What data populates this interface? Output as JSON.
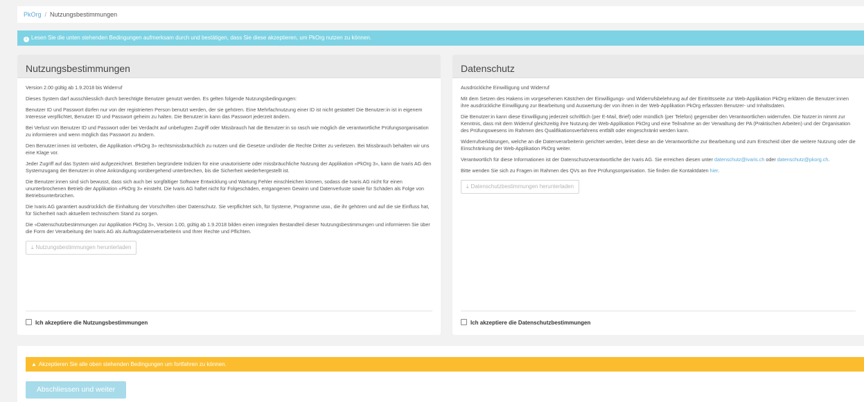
{
  "breadcrumb": {
    "root": "PkOrg",
    "separator": "/",
    "current": "Nutzungsbestimmungen"
  },
  "info_banner": "Lesen Sie die unten stehenden Bedingungen aufmerksam durch und bestätigen, dass Sie diese akzeptieren, um PkOrg nutzen zu können.",
  "terms": {
    "title": "Nutzungsbestimmungen",
    "paragraphs": [
      "Version 2.00 gültig ab 1.9.2018 bis Widerruf",
      "Dieses System darf ausschliesslich durch berechtigte Benutzer genutzt werden. Es gelten folgende Nutzungsbedingungen:",
      "Benutzer ID und Passwort dürfen nur von der registrierten Person benutzt werden, der sie gehören. Eine Mehrfachnutzung einer ID ist nicht gestattet! Die Benutzer:in ist in eigenem Interesse verpflichtet, Benutzer ID und Passwort geheim zu halten. Die Benutzer:in kann das Passwort jederzeit ändern.",
      "Bei Verlust von Benutzer ID und Passwort oder bei Verdacht auf unbefugten Zugriff oder Missbrauch hat die Benutzer:in so rasch wie möglich die verantwortliche Prüfungsorganisation zu informieren und wenn möglich das Passwort zu ändern.",
      "Den Benutzer:innen ist verboten, die Applikation «PkOrg 3» rechtsmissbräuchlich zu nutzen und die Gesetze und/oder die Rechte Dritter zu verletzen. Bei Missbrauch behalten wir uns eine Klage vor.",
      "Jeder Zugriff auf das System wird aufgezeichnet. Bestehen begründete Indizien für eine unautorisierte oder missbräuchliche Nutzung der Applikation «PkOrg 3», kann die Ivaris AG den Systemzugang der Benutzer:in ohne Ankündigung vorübergehend unterbrechen, bis die Sicherheit wiederhergestellt ist.",
      "Die Benutzer:innen sind sich bewusst, dass sich auch bei sorgfältiger Software Entwicklung und Wartung Fehler einschleichen können, sodass die Ivaris AG nicht für einen ununterbrochenen Betrieb der Applikation «PkOrg 3» einsteht. Die Ivaris AG haftet nicht für Folgeschäden, entgangenen Gewinn und Datenverluste sowie für Schäden als Folge von Betriebsunterbrüchen.",
      "Die Ivaris AG garantiert ausdrücklich die Einhaltung der Vorschriften über Datenschutz. Sie verpflichtet sich, für Systeme, Programme usw., die ihr gehören und auf die sie Einfluss hat, für Sicherheit nach aktuellem technischem Stand zu sorgen.",
      "Die «Datenschutzbestimmungen zur Applikation PkOrg 3», Version 1.00, gültig ab 1.9.2018 bilden einen integralen Bestandteil dieser Nutzungsbestimmungen und informieren Sie über die Form der Verarbeitung der Ivaris AG als Auftragsdatenverarbeiterin und Ihrer Rechte und Pflichten."
    ],
    "download_label": "Nutzungsbestimmungen herunterladen",
    "accept_label": "Ich akzeptiere die Nutzungsbestimmungen"
  },
  "privacy": {
    "title": "Datenschutz",
    "p1": "Ausdrückliche Einwilligung und Widerruf",
    "p2": "Mit dem Setzen des Hakens im vorgesehenen Kästchen der Einwilligungs- und Widerrufsbelehrung auf der Eintrittsseite zur Web-Applikation PkOrg erklären die Benutzer:innen ihre ausdrückliche Einwilligung zur Bearbeitung und Auswertung der von ihnen in der Web-Applikation PkOrg erfassten Benutzer- und Inhaltsdaten.",
    "p3": "Die Benutzer:in kann diese Einwilligung jederzeit schriftlich (per E-Mail, Brief) oder mündlich (per Telefon) gegenüber den Verantwortlichen widerrufen. Die Nutzer:in nimmt zur Kenntnis, dass mit dem Widerruf gleichzeitig ihre Nutzung der Web-Applikation PkOrg und eine Teilnahme an der Verwaltung der PA (Praktischen Arbeiten) und der Organisation des Prüfungswesens im Rahmen des Qualifikationsverfahrens entfällt oder eingeschränkt werden kann.",
    "p4": "Widerrufserklärungen, welche an die Datenverarbeiterin gerichtet werden, leitet diese an die Verantwortliche zur Bearbeitung und zum Entscheid über die weitere Nutzung oder die Einschränkung der Web-Applikation PkOrg weiter.",
    "p5_text": "Verantwortlich für diese Informationen ist der Datenschutzverantwortliche der Ivaris AG. Sie erreichen diesen unter",
    "p5_link1": "datenschutz@ivaris.ch",
    "p5_or": "oder",
    "p5_link2": "datenschutz@pkorg.ch",
    "p5_end": ".",
    "p6_text": "Bitte wenden Sie sich zu Fragen im Rahmen des QVs an Ihre Prüfungsorganisation. Sie finden die Kontaktdaten",
    "p6_link": "hier",
    "p6_end": ".",
    "download_label": "Datenschutzbestimmungen herunterladen",
    "accept_label": "Ich akzeptiere die Datenschutzbestimmungen"
  },
  "warning_banner": "Akzeptieren Sie alle oben stehenden Bedingungen um fortfahren zu können.",
  "continue_label": "Abschliessen und weiter",
  "icons": {
    "info": "info-circle-icon",
    "download": "download-icon",
    "warning": "warning-triangle-icon"
  },
  "colors": {
    "info": "#7dd3e3",
    "warning": "#fbbd2e",
    "button_disabled": "#a7dbe9",
    "link": "#5aa9d6"
  }
}
